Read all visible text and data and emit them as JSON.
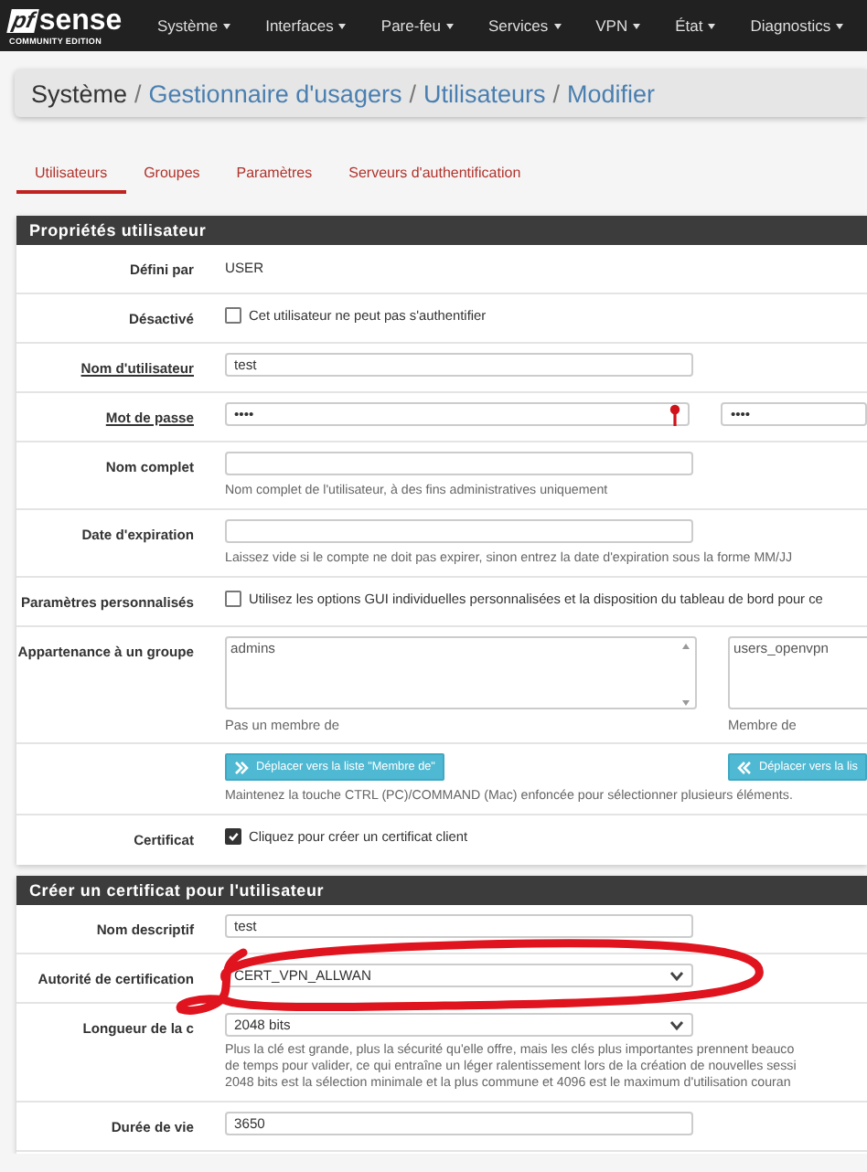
{
  "nav": {
    "logo_mark": "pf",
    "logo_text": "sense",
    "edition": "COMMUNITY EDITION",
    "menus": [
      "Système",
      "Interfaces",
      "Pare-feu",
      "Services",
      "VPN",
      "État",
      "Diagnostics"
    ]
  },
  "breadcrumb": {
    "separator": "/",
    "items": [
      {
        "label": "Système",
        "link": false
      },
      {
        "label": "Gestionnaire d'usagers",
        "link": true
      },
      {
        "label": "Utilisateurs",
        "link": true
      },
      {
        "label": "Modifier",
        "link": true
      }
    ]
  },
  "tabs": [
    {
      "label": "Utilisateurs",
      "selected": true
    },
    {
      "label": "Groupes",
      "selected": false
    },
    {
      "label": "Paramètres",
      "selected": false
    },
    {
      "label": "Serveurs d'authentification",
      "selected": false
    }
  ],
  "sections": [
    {
      "title": "Propriétés utilisateur",
      "rows": [
        {
          "kind": "static",
          "label": "Défini par",
          "value": "USER"
        },
        {
          "kind": "checkbox",
          "label": "Désactivé",
          "checked": false,
          "text": "Cet utilisateur ne peut pas s'authentifier"
        },
        {
          "kind": "text",
          "label": "Nom d'utilisateur",
          "required": true,
          "value": "test"
        },
        {
          "kind": "password",
          "label": "Mot de passe",
          "required": true,
          "value": "••••",
          "confirm": "••••"
        },
        {
          "kind": "text",
          "label": "Nom complet",
          "value": "",
          "help": "Nom complet de l'utilisateur, à des fins administratives uniquement"
        },
        {
          "kind": "text",
          "label": "Date d'expiration",
          "value": "",
          "help": "Laissez vide si le compte ne doit pas expirer, sinon entrez la date d'expiration sous la forme MM/JJ"
        },
        {
          "kind": "checkbox",
          "label": "Paramètres personnalisés",
          "checked": false,
          "text": "Utilisez les options GUI individuelles personnalisées et la disposition du tableau de bord pour ce"
        },
        {
          "kind": "groups",
          "label": "Appartenance à un groupe",
          "lists": [
            {
              "items": [
                "admins"
              ],
              "caption": "Pas un membre de"
            },
            {
              "items": [
                "users_openvpn"
              ],
              "caption": "Membre de"
            }
          ]
        },
        {
          "kind": "buttons",
          "buttons": [
            {
              "kind": "move-right",
              "label": "Déplacer vers la liste \"Membre de\""
            },
            {
              "kind": "move-left",
              "label": "Déplacer vers la lis"
            }
          ],
          "help": "Maintenez la touche CTRL (PC)/COMMAND (Mac) enfoncée pour sélectionner plusieurs éléments."
        },
        {
          "kind": "checkbox",
          "label": "Certificat",
          "checked": true,
          "text": "Cliquez pour créer un certificat client"
        }
      ]
    },
    {
      "title": "Créer un certificat pour l'utilisateur",
      "rows": [
        {
          "kind": "text",
          "label": "Nom descriptif",
          "value": "test"
        },
        {
          "kind": "select",
          "label": "Autorité de certification",
          "value": "CERT_VPN_ALLWAN"
        },
        {
          "kind": "select",
          "label": "Longueur de la c",
          "value": "2048 bits",
          "help_lines": [
            "Plus la clé est grande, plus la sécurité qu'elle offre, mais les clés plus importantes prennent beauco",
            "de temps pour valider, ce qui entraîne un léger ralentissement lors de la création de nouvelles sessi",
            "2048 bits est la sélection minimale et la plus commune et 4096 est le maximum d'utilisation couran"
          ]
        },
        {
          "kind": "text",
          "label": "Durée de vie",
          "value": "3650"
        }
      ]
    }
  ]
}
